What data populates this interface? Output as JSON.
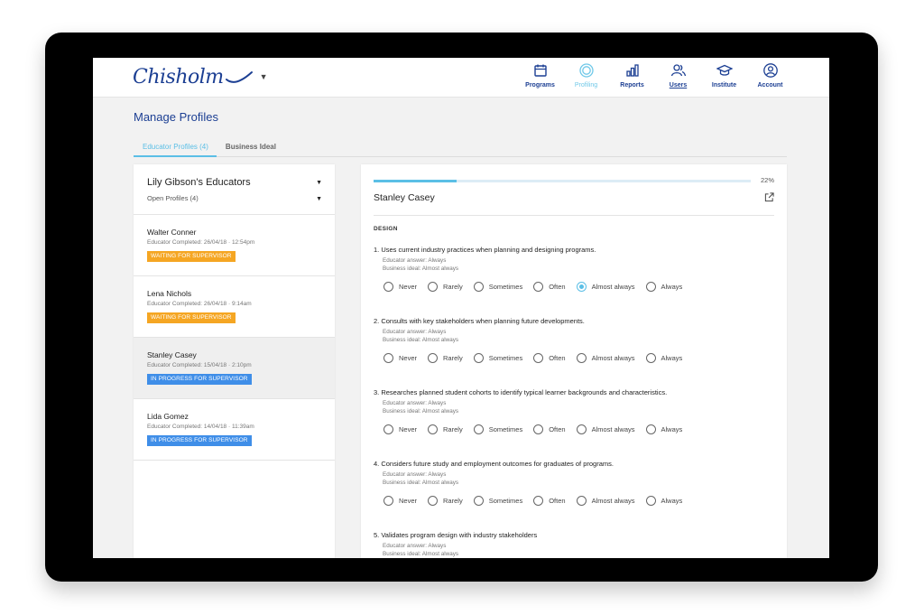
{
  "brand": {
    "logo_text": "Chisholm",
    "accent": "#1c3f93",
    "highlight": "#5bbfe6"
  },
  "nav": [
    {
      "label": "Programs",
      "icon": "calendar-icon"
    },
    {
      "label": "Profiling",
      "icon": "target-icon",
      "active": true
    },
    {
      "label": "Reports",
      "icon": "bar-chart-icon"
    },
    {
      "label": "Users",
      "icon": "users-icon"
    },
    {
      "label": "Institute",
      "icon": "graduation-cap-icon"
    },
    {
      "label": "Account",
      "icon": "account-icon"
    }
  ],
  "page": {
    "title": "Manage Profiles"
  },
  "tabs": [
    {
      "label": "Educator Profiles (4)",
      "active": true
    },
    {
      "label": "Business Ideal",
      "active": false
    }
  ],
  "left_panel": {
    "title": "Lily Gibson's Educators",
    "filter": "Open Profiles (4)",
    "educators": [
      {
        "name": "Walter Conner",
        "meta": "Educator Completed: 26/04/18 · 12:54pm",
        "status": "WAITING FOR SUPERVISOR",
        "status_color": "#f5a623"
      },
      {
        "name": "Lena Nichols",
        "meta": "Educator Completed: 26/04/18 · 9:14am",
        "status": "WAITING FOR SUPERVISOR",
        "status_color": "#f5a623"
      },
      {
        "name": "Stanley Casey",
        "meta": "Educator Completed: 15/04/18 · 2:10pm",
        "status": "IN PROGRESS FOR SUPERVISOR",
        "status_color": "#3f8ee8",
        "selected": true
      },
      {
        "name": "Lida Gomez",
        "meta": "Educator Completed: 14/04/18 · 11:39am",
        "status": "IN PROGRESS FOR SUPERVISOR",
        "status_color": "#3f8ee8"
      }
    ]
  },
  "profile": {
    "name": "Stanley Casey",
    "progress_label": "22%",
    "progress_value": 0.22,
    "section": "DESIGN",
    "options": [
      "Never",
      "Rarely",
      "Sometimes",
      "Often",
      "Almost always",
      "Always"
    ],
    "questions": [
      {
        "text": "1. Uses current industry practices when planning and designing programs.",
        "educator": "Educator answer: Always",
        "ideal": "Business ideal: Almost always",
        "selected": "Almost always"
      },
      {
        "text": "2. Consults with key stakeholders when planning future developments.",
        "educator": "Educator answer: Always",
        "ideal": "Business ideal: Almost always",
        "selected": null
      },
      {
        "text": "3. Researches planned student cohorts to identify typical learner backgrounds and characteristics.",
        "educator": "Educator answer: Always",
        "ideal": "Business ideal: Almost always",
        "selected": null
      },
      {
        "text": "4. Considers future study and employment outcomes for graduates of programs.",
        "educator": "Educator answer: Always",
        "ideal": "Business ideal: Almost always",
        "selected": null
      },
      {
        "text": "5. Validates program design with industry stakeholders",
        "educator": "Educator answer: Always",
        "ideal": "Business ideal: Almost always",
        "selected": null
      }
    ]
  }
}
